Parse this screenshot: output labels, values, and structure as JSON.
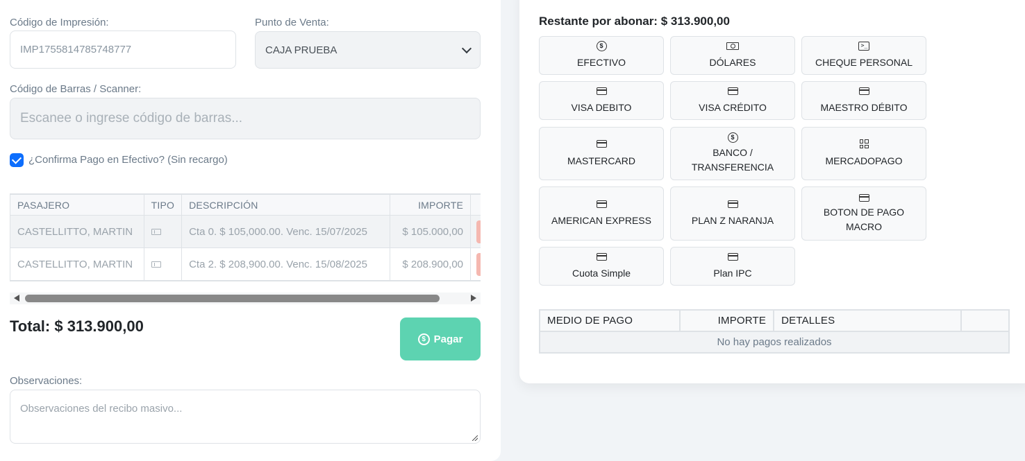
{
  "form": {
    "codigo_impresion_label": "Código de Impresión:",
    "codigo_impresion_value": "IMP1755814785748777",
    "punto_venta_label": "Punto de Venta:",
    "punto_venta_value": "CAJA PRUEBA",
    "barcode_label": "Código de Barras / Scanner:",
    "barcode_placeholder": "Escanee o ingrese código de barras...",
    "confirm_cash_label": "¿Confirma Pago en Efectivo? (Sin recargo)",
    "confirm_cash_checked": true
  },
  "items_table": {
    "headers": [
      "PASAJERO",
      "TIPO",
      "DESCRIPCIÓN",
      "IMPORTE"
    ],
    "rows": [
      {
        "pasajero": "CASTELLITTO, MARTIN",
        "tipo_icon": "ticket-icon",
        "descripcion": "Cta 0. $ 105,000.00. Venc. 15/07/2025",
        "importe": "$ 105.000,00"
      },
      {
        "pasajero": "CASTELLITTO, MARTIN",
        "tipo_icon": "ticket-icon",
        "descripcion": "Cta 2. $ 208,900.00. Venc. 15/08/2025",
        "importe": "$ 208.900,00"
      }
    ]
  },
  "summary": {
    "total": "Total: $ 313.900,00",
    "pay_button": "Pagar"
  },
  "observaciones": {
    "label": "Observaciones:",
    "placeholder": "Observaciones del recibo masivo..."
  },
  "payment": {
    "restante": "Restante por abonar: $ 313.900,00",
    "methods": [
      {
        "label": "EFECTIVO",
        "icon": "coin-icon"
      },
      {
        "label": "DÓLARES",
        "icon": "cash-icon"
      },
      {
        "label": "CHEQUE PERSONAL",
        "icon": "terminal-icon"
      },
      {
        "label": "VISA DEBITO",
        "icon": "credit-card-icon"
      },
      {
        "label": "VISA CRÉDITO",
        "icon": "credit-card-icon"
      },
      {
        "label": "MAESTRO DÉBITO",
        "icon": "credit-card-icon"
      },
      {
        "label": "MASTERCARD",
        "icon": "credit-card-icon"
      },
      {
        "label": "BANCO / TRANSFERENCIA",
        "icon": "coin-icon"
      },
      {
        "label": "MERCADOPAGO",
        "icon": "qr-code-icon"
      },
      {
        "label": "AMERICAN EXPRESS",
        "icon": "credit-card-icon"
      },
      {
        "label": "PLAN Z NARANJA",
        "icon": "credit-card-icon"
      },
      {
        "label": "BOTON DE PAGO MACRO",
        "icon": "credit-card-icon"
      },
      {
        "label": "Cuota Simple",
        "icon": "credit-card-icon"
      },
      {
        "label": "Plan IPC",
        "icon": "credit-card-icon"
      }
    ],
    "table_headers": [
      "MEDIO DE PAGO",
      "IMPORTE",
      "DETALLES",
      ""
    ],
    "empty_message": "No hay pagos realizados"
  }
}
